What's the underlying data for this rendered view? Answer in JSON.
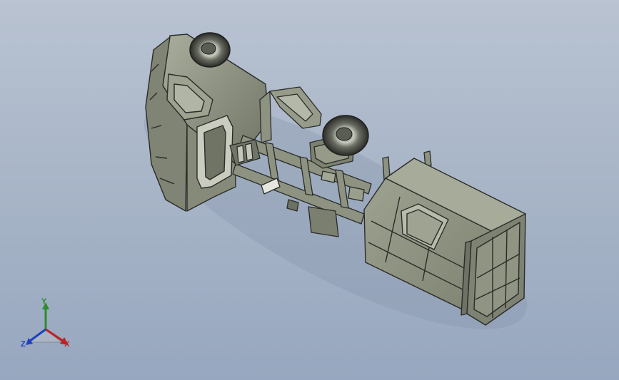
{
  "viewport": {
    "background_top": "#b9c3d2",
    "background_bottom": "#97a7bf",
    "model_color": "#8f9484",
    "edge_color": "#2a2c28"
  },
  "model": {
    "name_icon": "garbage-truck-3d-model"
  },
  "triad": {
    "y_label": "Y",
    "x_label": "X",
    "z_label": "Z",
    "y_color": "#2e8b2e",
    "x_color": "#c02020",
    "z_color": "#2040c0"
  }
}
